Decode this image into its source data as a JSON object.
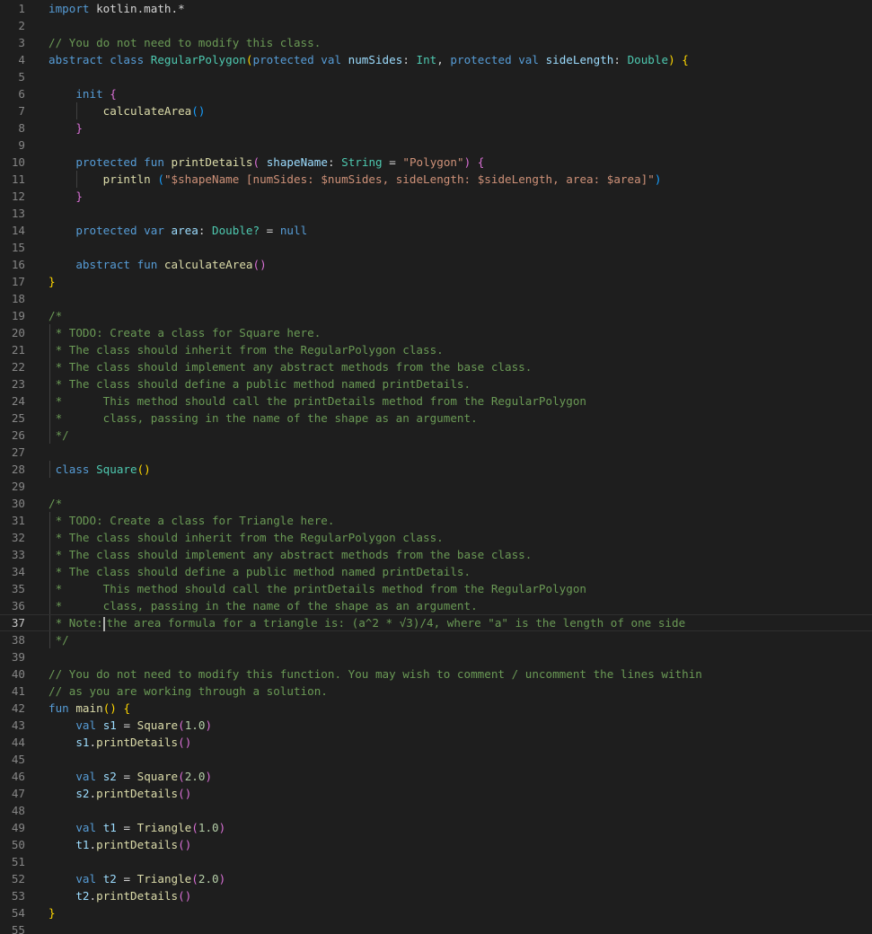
{
  "editor": {
    "language": "kotlin",
    "current_line": 37,
    "line_numbers": [
      "1",
      "2",
      "3",
      "4",
      "5",
      "6",
      "7",
      "8",
      "9",
      "10",
      "11",
      "12",
      "13",
      "14",
      "15",
      "16",
      "17",
      "18",
      "19",
      "20",
      "21",
      "22",
      "23",
      "24",
      "25",
      "26",
      "27",
      "28",
      "29",
      "30",
      "31",
      "32",
      "33",
      "34",
      "35",
      "36",
      "37",
      "38",
      "39",
      "40",
      "41",
      "42",
      "43",
      "44",
      "45",
      "46",
      "47",
      "48",
      "49",
      "50",
      "51",
      "52",
      "53",
      "54",
      "55"
    ],
    "lines": [
      [
        [
          "kw",
          "import"
        ],
        [
          "pl",
          " kotlin.math.*"
        ]
      ],
      [],
      [
        [
          "cm",
          "// You do not need to modify this class."
        ]
      ],
      [
        [
          "kw",
          "abstract class "
        ],
        [
          "ty",
          "RegularPolygon"
        ],
        [
          "br1",
          "("
        ],
        [
          "kw",
          "protected val "
        ],
        [
          "var",
          "numSides"
        ],
        [
          "pl",
          ": "
        ],
        [
          "ty",
          "Int"
        ],
        [
          "pl",
          ", "
        ],
        [
          "kw",
          "protected val "
        ],
        [
          "var",
          "sideLength"
        ],
        [
          "pl",
          ": "
        ],
        [
          "ty",
          "Double"
        ],
        [
          "br1",
          ")"
        ],
        [
          "pl",
          " "
        ],
        [
          "br1",
          "{"
        ]
      ],
      [],
      [
        [
          "pl",
          "    "
        ],
        [
          "kw",
          "init"
        ],
        [
          "pl",
          " "
        ],
        [
          "br2",
          "{"
        ]
      ],
      [
        [
          "pl",
          "        "
        ],
        [
          "fn",
          "calculateArea"
        ],
        [
          "br3",
          "()"
        ]
      ],
      [
        [
          "pl",
          "    "
        ],
        [
          "br2",
          "}"
        ]
      ],
      [],
      [
        [
          "pl",
          "    "
        ],
        [
          "kw",
          "protected fun "
        ],
        [
          "fn",
          "printDetails"
        ],
        [
          "br2",
          "("
        ],
        [
          "pl",
          " "
        ],
        [
          "var",
          "shapeName"
        ],
        [
          "pl",
          ": "
        ],
        [
          "ty",
          "String"
        ],
        [
          "pl",
          " = "
        ],
        [
          "str",
          "\"Polygon\""
        ],
        [
          "br2",
          ")"
        ],
        [
          "pl",
          " "
        ],
        [
          "br2",
          "{"
        ]
      ],
      [
        [
          "pl",
          "        "
        ],
        [
          "fn",
          "println"
        ],
        [
          "pl",
          " "
        ],
        [
          "br3",
          "("
        ],
        [
          "str",
          "\"$shapeName [numSides: $numSides, sideLength: $sideLength, area: $area]\""
        ],
        [
          "br3",
          ")"
        ]
      ],
      [
        [
          "pl",
          "    "
        ],
        [
          "br2",
          "}"
        ]
      ],
      [],
      [
        [
          "pl",
          "    "
        ],
        [
          "kw",
          "protected var "
        ],
        [
          "var",
          "area"
        ],
        [
          "pl",
          ": "
        ],
        [
          "ty",
          "Double?"
        ],
        [
          "pl",
          " = "
        ],
        [
          "kw",
          "null"
        ]
      ],
      [],
      [
        [
          "pl",
          "    "
        ],
        [
          "kw",
          "abstract fun "
        ],
        [
          "fn",
          "calculateArea"
        ],
        [
          "br2",
          "()"
        ]
      ],
      [
        [
          "br1",
          "}"
        ]
      ],
      [],
      [
        [
          "cm",
          "/*"
        ]
      ],
      [
        [
          "cm",
          " * TODO: Create a class for Square here."
        ]
      ],
      [
        [
          "cm",
          " * The class should inherit from the RegularPolygon class."
        ]
      ],
      [
        [
          "cm",
          " * The class should implement any abstract methods from the base class."
        ]
      ],
      [
        [
          "cm",
          " * The class should define a public method named printDetails."
        ]
      ],
      [
        [
          "cm",
          " *      This method should call the printDetails method from the RegularPolygon"
        ]
      ],
      [
        [
          "cm",
          " *      class, passing in the name of the shape as an argument."
        ]
      ],
      [
        [
          "cm",
          " */"
        ]
      ],
      [],
      [
        [
          "pl",
          " "
        ],
        [
          "kw",
          "class "
        ],
        [
          "ty",
          "Square"
        ],
        [
          "br1",
          "()"
        ]
      ],
      [],
      [
        [
          "cm",
          "/*"
        ]
      ],
      [
        [
          "cm",
          " * TODO: Create a class for Triangle here."
        ]
      ],
      [
        [
          "cm",
          " * The class should inherit from the RegularPolygon class."
        ]
      ],
      [
        [
          "cm",
          " * The class should implement any abstract methods from the base class."
        ]
      ],
      [
        [
          "cm",
          " * The class should define a public method named printDetails."
        ]
      ],
      [
        [
          "cm",
          " *      This method should call the printDetails method from the RegularPolygon"
        ]
      ],
      [
        [
          "cm",
          " *      class, passing in the name of the shape as an argument."
        ]
      ],
      [
        [
          "cm",
          " * Note:"
        ],
        [
          "cursor",
          ""
        ],
        [
          "cm",
          "the area formula for a triangle is: (a^2 * √3)/4, where \"a\" is the length of one side"
        ]
      ],
      [
        [
          "cm",
          " */"
        ]
      ],
      [],
      [
        [
          "cm",
          "// You do not need to modify this function. You may wish to comment / uncomment the lines within"
        ]
      ],
      [
        [
          "cm",
          "// as you are working through a solution."
        ]
      ],
      [
        [
          "kw",
          "fun "
        ],
        [
          "fn",
          "main"
        ],
        [
          "br1",
          "()"
        ],
        [
          "pl",
          " "
        ],
        [
          "br1",
          "{"
        ]
      ],
      [
        [
          "pl",
          "    "
        ],
        [
          "kw",
          "val "
        ],
        [
          "var",
          "s1"
        ],
        [
          "pl",
          " = "
        ],
        [
          "fn",
          "Square"
        ],
        [
          "br2",
          "("
        ],
        [
          "num",
          "1.0"
        ],
        [
          "br2",
          ")"
        ]
      ],
      [
        [
          "pl",
          "    "
        ],
        [
          "var",
          "s1"
        ],
        [
          "pl",
          "."
        ],
        [
          "fn",
          "printDetails"
        ],
        [
          "br2",
          "()"
        ]
      ],
      [],
      [
        [
          "pl",
          "    "
        ],
        [
          "kw",
          "val "
        ],
        [
          "var",
          "s2"
        ],
        [
          "pl",
          " = "
        ],
        [
          "fn",
          "Square"
        ],
        [
          "br2",
          "("
        ],
        [
          "num",
          "2.0"
        ],
        [
          "br2",
          ")"
        ]
      ],
      [
        [
          "pl",
          "    "
        ],
        [
          "var",
          "s2"
        ],
        [
          "pl",
          "."
        ],
        [
          "fn",
          "printDetails"
        ],
        [
          "br2",
          "()"
        ]
      ],
      [],
      [
        [
          "pl",
          "    "
        ],
        [
          "kw",
          "val "
        ],
        [
          "var",
          "t1"
        ],
        [
          "pl",
          " = "
        ],
        [
          "fn",
          "Triangle"
        ],
        [
          "br2",
          "("
        ],
        [
          "num",
          "1.0"
        ],
        [
          "br2",
          ")"
        ]
      ],
      [
        [
          "pl",
          "    "
        ],
        [
          "var",
          "t1"
        ],
        [
          "pl",
          "."
        ],
        [
          "fn",
          "printDetails"
        ],
        [
          "br2",
          "()"
        ]
      ],
      [],
      [
        [
          "pl",
          "    "
        ],
        [
          "kw",
          "val "
        ],
        [
          "var",
          "t2"
        ],
        [
          "pl",
          " = "
        ],
        [
          "fn",
          "Triangle"
        ],
        [
          "br2",
          "("
        ],
        [
          "num",
          "2.0"
        ],
        [
          "br2",
          ")"
        ]
      ],
      [
        [
          "pl",
          "    "
        ],
        [
          "var",
          "t2"
        ],
        [
          "pl",
          "."
        ],
        [
          "fn",
          "printDetails"
        ],
        [
          "br2",
          "()"
        ]
      ],
      [
        [
          "br1",
          "}"
        ]
      ],
      []
    ]
  }
}
